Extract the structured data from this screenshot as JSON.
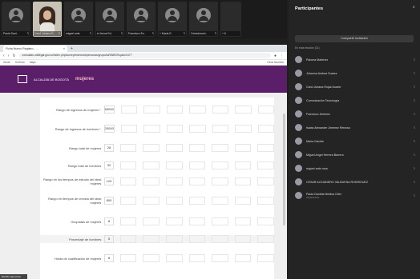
{
  "meeting": {
    "tiles": [
      {
        "name": "Paula Dani..",
        "type": "avatar"
      },
      {
        "name": "Carol Johana R..",
        "type": "video"
      },
      {
        "name": "miguel ante",
        "type": "avatar"
      },
      {
        "name": "el Jesus Ed..",
        "type": "avatar"
      },
      {
        "name": "Francisco Es..",
        "type": "avatar"
      },
      {
        "name": "+ Maria E..",
        "type": "avatar"
      },
      {
        "name": "Ceriaduroch..",
        "type": "avatar"
      },
      {
        "name": "+ 6",
        "type": "more"
      }
    ]
  },
  "browser": {
    "tab_title": "Ficha Nuevo Registro - ...",
    "url": "consultas.unillegal.gov.co/index.php/survey/index/sid/personas/grupo/lid/938929/quilo/2477",
    "bookmarks": [
      "Gmail",
      "YouTube",
      "Maps"
    ],
    "bookmarks_right": "Otros favoritos"
  },
  "page": {
    "logo_text": "ALCALDÍA DE BOGOTÁ",
    "brand": "mujeres",
    "toast": "Escribe aquí para buscar",
    "rows": [
      {
        "label": "Rango de ingresos de mujeres *",
        "value": "50000"
      },
      {
        "label": "Rango de ingresos de hombres *",
        "value": "20000"
      },
      {
        "label": "Rango total de mujeres",
        "value": "28"
      },
      {
        "label": "Rango total de hombres",
        "value": "32"
      },
      {
        "label": "Rango en los tiempos de estudio del ideal mujeres",
        "value": "129"
      },
      {
        "label": "Rango en tiempos de crecida del ideal mujeres",
        "value": "800"
      },
      {
        "label": "Ocupadas de mujeres",
        "value": "8"
      },
      {
        "label": "Porcentaje de hombres",
        "value": "5"
      },
      {
        "label": "Horas de cualificación de mujeres",
        "value": "8"
      }
    ]
  },
  "participants": {
    "title": "Participantes",
    "share_button": "Compartir invitación",
    "section": "En esta reunión (11)",
    "people": [
      {
        "name": "Paloma Martínez",
        "sub": ""
      },
      {
        "name": "Johanna Andrea Suarez",
        "sub": ""
      },
      {
        "name": "Carol Johana Rojas Duarte",
        "sub": ""
      },
      {
        "name": "Comunicación Tecnología",
        "sub": ""
      },
      {
        "name": "Francisco Jiménez",
        "sub": ""
      },
      {
        "name": "Isaias Alexander Jimenez Reinoso",
        "sub": ""
      },
      {
        "name": "María Gaviria",
        "sub": ""
      },
      {
        "name": "Miguel Angel Herrera Barrero",
        "sub": ""
      },
      {
        "name": "miguel ante rosa",
        "sub": ""
      },
      {
        "name": "CESAR ALEJANDRO VALBUENA RODRIGUEZ",
        "sub": ""
      },
      {
        "name": "Paula Daniela Medina Ortiz",
        "sub": "Organizador"
      }
    ]
  }
}
